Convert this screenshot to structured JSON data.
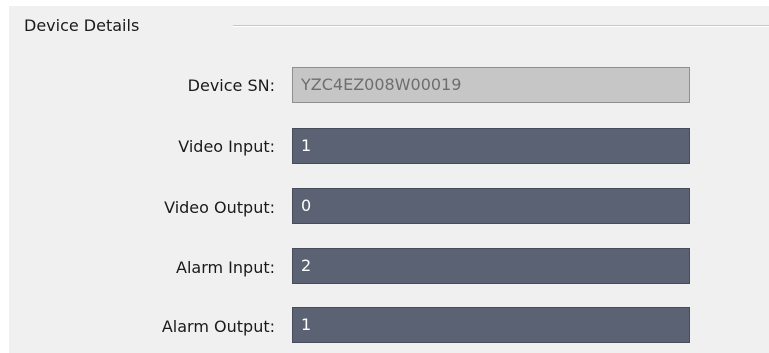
{
  "section": {
    "title": "Device Details"
  },
  "fields": [
    {
      "label": "Device SN:",
      "value": "YZC4EZ008W00019"
    },
    {
      "label": "Video Input:",
      "value": "1"
    },
    {
      "label": "Video Output:",
      "value": "0"
    },
    {
      "label": "Alarm Input:",
      "value": "2"
    },
    {
      "label": "Alarm Output:",
      "value": "1"
    }
  ]
}
